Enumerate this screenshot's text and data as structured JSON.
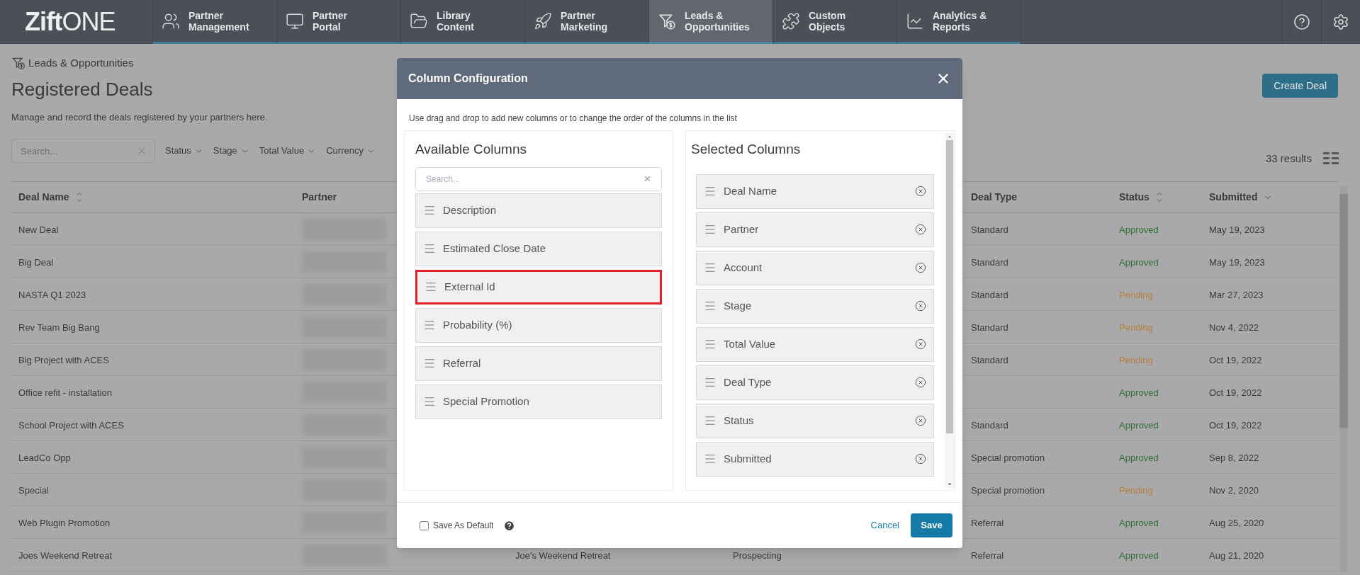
{
  "nav": {
    "logo_bold": "Zift",
    "logo_light": "ONE",
    "items": [
      {
        "kind": "users",
        "line1": "Partner",
        "line2": "Management",
        "selected": false
      },
      {
        "kind": "monitor",
        "line1": "Partner",
        "line2": "Portal",
        "selected": false
      },
      {
        "kind": "folder",
        "line1": "Library",
        "line2": "Content",
        "selected": false
      },
      {
        "kind": "rocket",
        "line1": "Partner",
        "line2": "Marketing",
        "selected": false
      },
      {
        "kind": "funnel",
        "line1": "Leads &",
        "line2": "Opportunities",
        "selected": true
      },
      {
        "kind": "puzzle",
        "line1": "Custom",
        "line2": "Objects",
        "selected": false
      },
      {
        "kind": "chart",
        "line1": "Analytics &",
        "line2": "Reports",
        "selected": false
      }
    ]
  },
  "page": {
    "breadcrumb": "Leads & Opportunities",
    "title": "Registered Deals",
    "description": "Manage and record the deals registered by your partners here.",
    "create_button": "Create Deal",
    "search_placeholder": "Search...",
    "filters": [
      "Status",
      "Stage",
      "Total Value",
      "Currency"
    ],
    "results": "33 results"
  },
  "table": {
    "columns": [
      {
        "label": "Deal Name",
        "sortable": true,
        "sorted": false
      },
      {
        "label": "Partner",
        "sortable": false,
        "sorted": false
      },
      {
        "label": "Deal Type",
        "sortable": false,
        "sorted": false
      },
      {
        "label": "Status",
        "sortable": true,
        "sorted": false
      },
      {
        "label": "Submitted",
        "sortable": true,
        "sorted": true
      }
    ],
    "rows": [
      {
        "deal_name": "New Deal",
        "deal_type": "Standard",
        "status": "Approved",
        "color": "#2f6f33",
        "submitted": "May 19, 2023"
      },
      {
        "deal_name": "Big Deal",
        "deal_type": "Standard",
        "status": "Approved",
        "color": "#2f6f33",
        "submitted": "May 19, 2023"
      },
      {
        "deal_name": "NASTA Q1 2023",
        "deal_type": "Standard",
        "status": "Pending",
        "color": "#b8803a",
        "submitted": "Mar 27, 2023"
      },
      {
        "deal_name": "Rev Team Big Bang",
        "deal_type": "Standard",
        "status": "Pending",
        "color": "#b8803a",
        "submitted": "Nov 4, 2022"
      },
      {
        "deal_name": "Big Project with ACES",
        "deal_type": "Standard",
        "status": "Pending",
        "color": "#b8803a",
        "submitted": "Oct 19, 2022"
      },
      {
        "deal_name": "Office refit - installation",
        "status": "Approved",
        "color": "#2f6f33",
        "submitted": "Oct 19, 2022"
      },
      {
        "deal_name": "School Project with ACES",
        "deal_type": "Standard",
        "status": "Approved",
        "color": "#2f6f33",
        "submitted": "Oct 19, 2022"
      },
      {
        "deal_name": "LeadCo Opp",
        "deal_type": "Special promotion",
        "status": "Approved",
        "color": "#2f6f33",
        "submitted": "Sep 8, 2022"
      },
      {
        "deal_name": "Special",
        "deal_type": "Special promotion",
        "status": "Pending",
        "color": "#b8803a",
        "submitted": "Nov 2, 2020"
      },
      {
        "deal_name": "Web Plugin Promotion",
        "deal_type": "Referral",
        "status": "Approved",
        "color": "#2f6f33",
        "submitted": "Aug 25, 2020"
      },
      {
        "deal_name": "Joes Weekend Retreat",
        "account": "Joe's Weekend Retreat",
        "stage": "Prospecting",
        "deal_type": "Referral",
        "status": "Approved",
        "color": "#2f6f33",
        "submitted": "Aug 21, 2020"
      }
    ]
  },
  "modal": {
    "title": "Column Configuration",
    "instruction": "Use drag and drop to add new columns or to change the order of the columns in the list",
    "available": {
      "heading": "Available Columns",
      "search_placeholder": "Search...",
      "items": [
        {
          "label": "Description",
          "highlighted": false
        },
        {
          "label": "Estimated Close Date",
          "highlighted": false
        },
        {
          "label": "External Id",
          "highlighted": true
        },
        {
          "label": "Probability (%)",
          "highlighted": false
        },
        {
          "label": "Referral",
          "highlighted": false
        },
        {
          "label": "Special Promotion",
          "highlighted": false
        }
      ]
    },
    "selected": {
      "heading": "Selected Columns",
      "items": [
        "Deal Name",
        "Partner",
        "Account",
        "Stage",
        "Total Value",
        "Deal Type",
        "Status",
        "Submitted"
      ]
    },
    "save_default": {
      "label": "Save As Default",
      "checked": false
    },
    "cancel": "Cancel",
    "save": "Save"
  }
}
